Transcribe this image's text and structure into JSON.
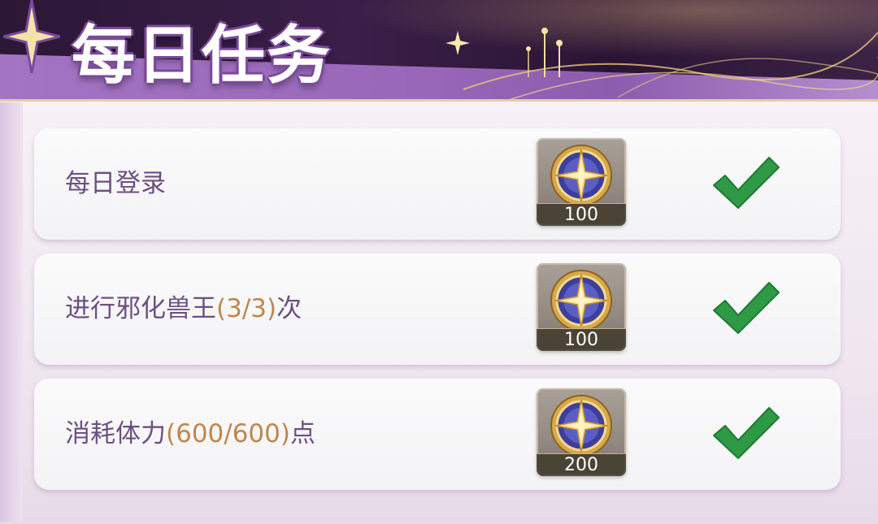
{
  "header": {
    "title": "每日任务"
  },
  "tasks": [
    {
      "label_main": "每日登录",
      "progress": "",
      "label_suffix": "",
      "reward_icon": "star-compass-coin-icon",
      "reward_count": "100",
      "completed": true
    },
    {
      "label_main": "进行邪化兽王",
      "progress": "(3/3)",
      "label_suffix": "次",
      "reward_icon": "star-compass-coin-icon",
      "reward_count": "100",
      "completed": true
    },
    {
      "label_main": "消耗体力",
      "progress": "(600/600)",
      "label_suffix": "点",
      "reward_icon": "star-compass-coin-icon",
      "reward_count": "200",
      "completed": true
    }
  ],
  "colors": {
    "accent_purple": "#9a68ba",
    "progress_text": "#c1864c",
    "label_text": "#6d4f82",
    "check_green": "#2f9a45"
  }
}
